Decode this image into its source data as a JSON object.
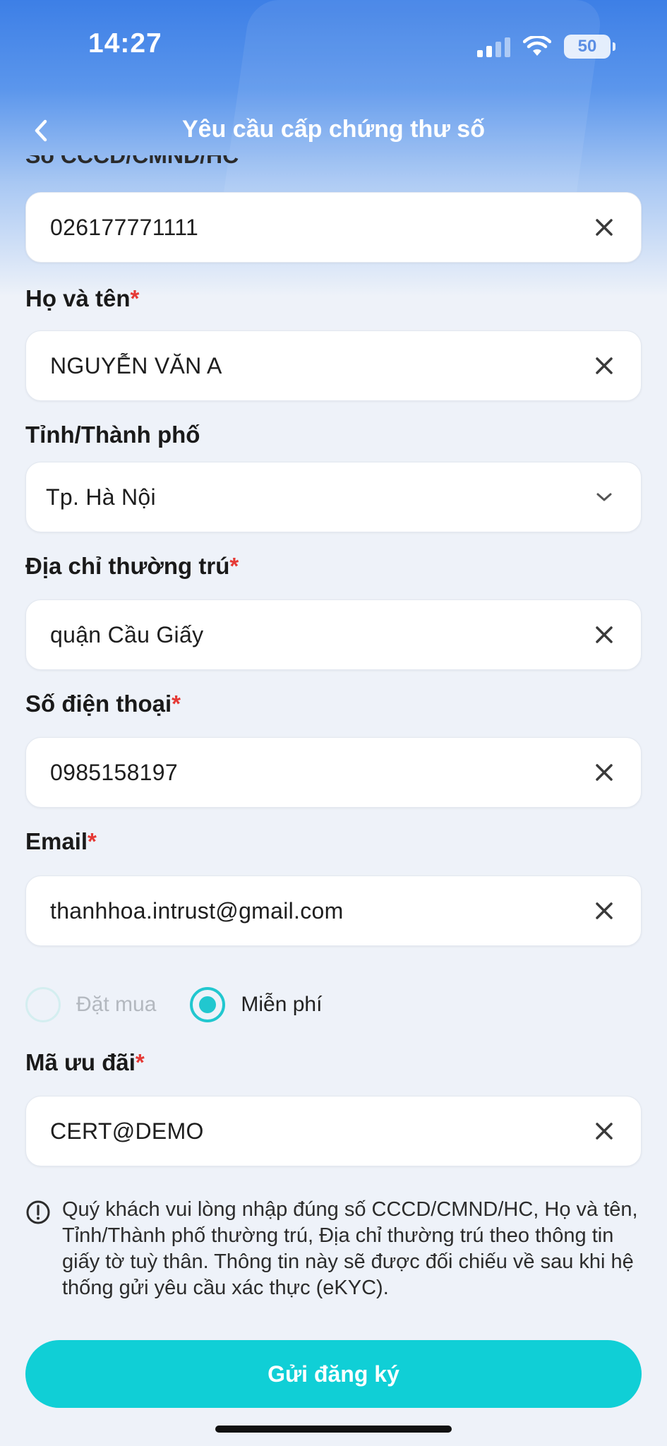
{
  "status_bar": {
    "time": "14:27",
    "battery": "50"
  },
  "header": {
    "title": "Yêu cầu cấp chứng thư số",
    "partial_label": "Số CCCD/CMND/HC"
  },
  "fields": {
    "id_number": {
      "value": "026177771111"
    },
    "full_name": {
      "label": "Họ và tên",
      "required": "*",
      "value": "NGUYỄN VĂN A"
    },
    "province": {
      "label": "Tỉnh/Thành phố",
      "value": "Tp. Hà Nội"
    },
    "address": {
      "label": "Địa chỉ thường trú",
      "required": "*",
      "value": "quận Cầu Giấy"
    },
    "phone": {
      "label": "Số điện thoại",
      "required": "*",
      "value": "0985158197"
    },
    "email": {
      "label": "Email",
      "required": "*",
      "value": "thanhhoa.intrust@gmail.com"
    },
    "promo": {
      "label": "Mã ưu đãi",
      "required": "*",
      "value": "CERT@DEMO"
    }
  },
  "payment_options": [
    {
      "label": "Đặt mua",
      "selected": false
    },
    {
      "label": "Miễn phí",
      "selected": true
    }
  ],
  "note": "Quý khách vui lòng nhập đúng số CCCD/CMND/HC, Họ và tên, Tỉnh/Thành phố thường trú, Địa chỉ thường trú theo thông tin giấy tờ tuỳ thân. Thông tin này sẽ được đối chiếu về sau khi hệ thống gửi yêu cầu xác thực (eKYC).",
  "submit_label": "Gửi đăng ký",
  "colors": {
    "accent": "#10cfd6",
    "required": "#e53935",
    "header": "#3d7fe6"
  }
}
